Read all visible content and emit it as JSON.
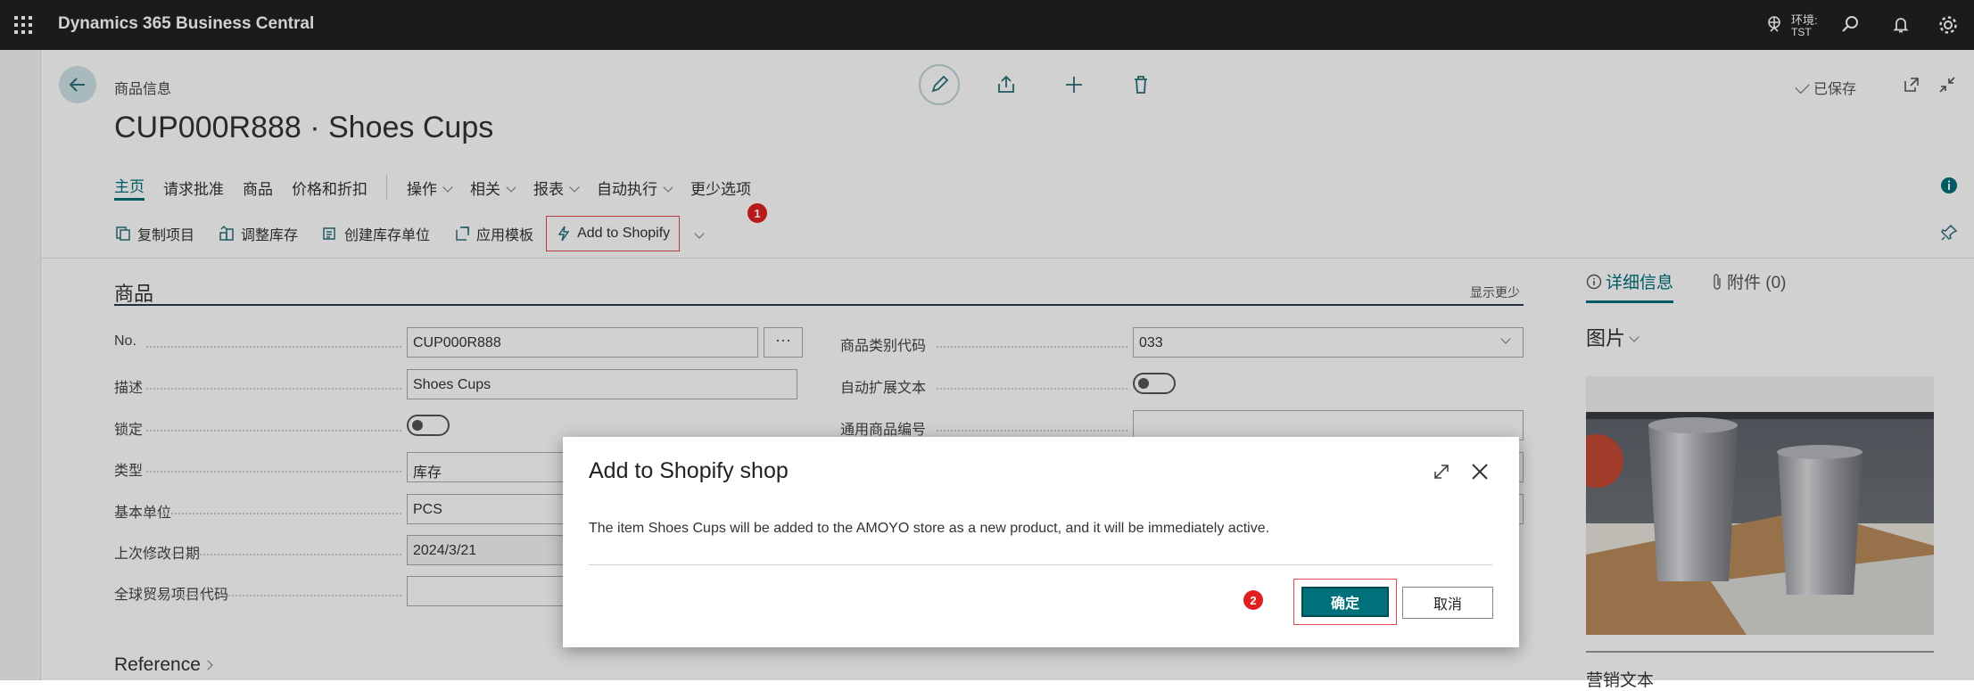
{
  "app": {
    "title": "Dynamics 365 Business Central"
  },
  "environment": {
    "label": "环境:",
    "value": "TST"
  },
  "topbar_icons": [
    "environment-icon",
    "search-icon",
    "bell-icon",
    "gear-icon"
  ],
  "header": {
    "breadcrumb": "商品信息",
    "title": "CUP000R888 · Shoes Cups",
    "saved": "已保存"
  },
  "menu": {
    "items": [
      "主页",
      "请求批准",
      "商品",
      "价格和折扣"
    ],
    "dropdowns": [
      "操作",
      "相关",
      "报表",
      "自动执行"
    ],
    "more": "更少选项"
  },
  "actions": {
    "copy": "复制项目",
    "adjust": "调整库存",
    "create_sku": "创建库存单位",
    "apply_template": "应用模板",
    "shopify": "Add to Shopify"
  },
  "section": {
    "title": "商品",
    "toggle": "显示更少"
  },
  "fields_left": [
    {
      "label": "No.",
      "value": "CUP000R888"
    },
    {
      "label": "描述",
      "value": "Shoes Cups"
    },
    {
      "label": "锁定",
      "value": ""
    },
    {
      "label": "类型",
      "value": "库存"
    },
    {
      "label": "基本单位",
      "value": "PCS"
    },
    {
      "label": "上次修改日期",
      "value": "2024/3/21"
    },
    {
      "label": "全球贸易项目代码",
      "value": ""
    }
  ],
  "fields_right": [
    {
      "label": "商品类别代码",
      "value": "033"
    },
    {
      "label": "自动扩展文本",
      "value": ""
    },
    {
      "label": "通用商品编号",
      "value": ""
    }
  ],
  "reference": {
    "label": "Reference"
  },
  "factbox": {
    "tab_details": "详细信息",
    "tab_attachments": "附件 (0)",
    "picture_title": "图片",
    "next_title": "营销文本"
  },
  "dialog": {
    "title": "Add to Shopify shop",
    "message": "The item Shoes Cups will be added to the AMOYO store as a new product, and it will be immediately active.",
    "ok": "确定",
    "cancel": "取消"
  },
  "badges": {
    "one": "1",
    "two": "2"
  },
  "colors": {
    "accent": "#00707a",
    "highlight": "#e04b4b",
    "topbar": "#212121"
  }
}
